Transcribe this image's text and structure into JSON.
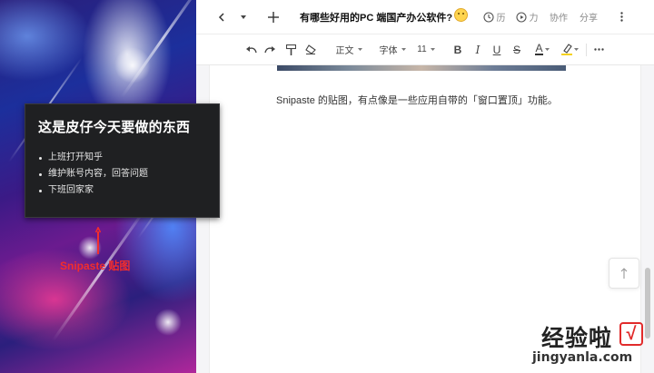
{
  "snipaste": {
    "title": "这是皮仔今天要做的东西",
    "items": [
      {
        "label": "上班打开知乎"
      },
      {
        "label": "维护账号内容，回答问题"
      },
      {
        "label": "下班回家家"
      }
    ],
    "caption": "Snipaste 贴图"
  },
  "titlebar": {
    "doc_title": "有哪些好用的PC 端国产办公软件?",
    "history_label": "历",
    "play_label": "力",
    "collaborate_label": "协作",
    "share_label": "分享"
  },
  "toolbar": {
    "paragraph_style": "正文",
    "font_family": "字体",
    "font_size": "11",
    "bold": "B",
    "italic": "I",
    "underline": "U",
    "strike": "S",
    "font_color": "A"
  },
  "document": {
    "paragraph": "Snipaste 的贴图，有点像是一些应用自带的「窗口置顶」功能。"
  },
  "watermark": {
    "text": "经验啦",
    "url": "jingyanla.com",
    "check": "√"
  },
  "colors": {
    "caption_red": "#f22d2d",
    "card_bg": "#1f2022",
    "watermark_red": "#e12b2b"
  }
}
